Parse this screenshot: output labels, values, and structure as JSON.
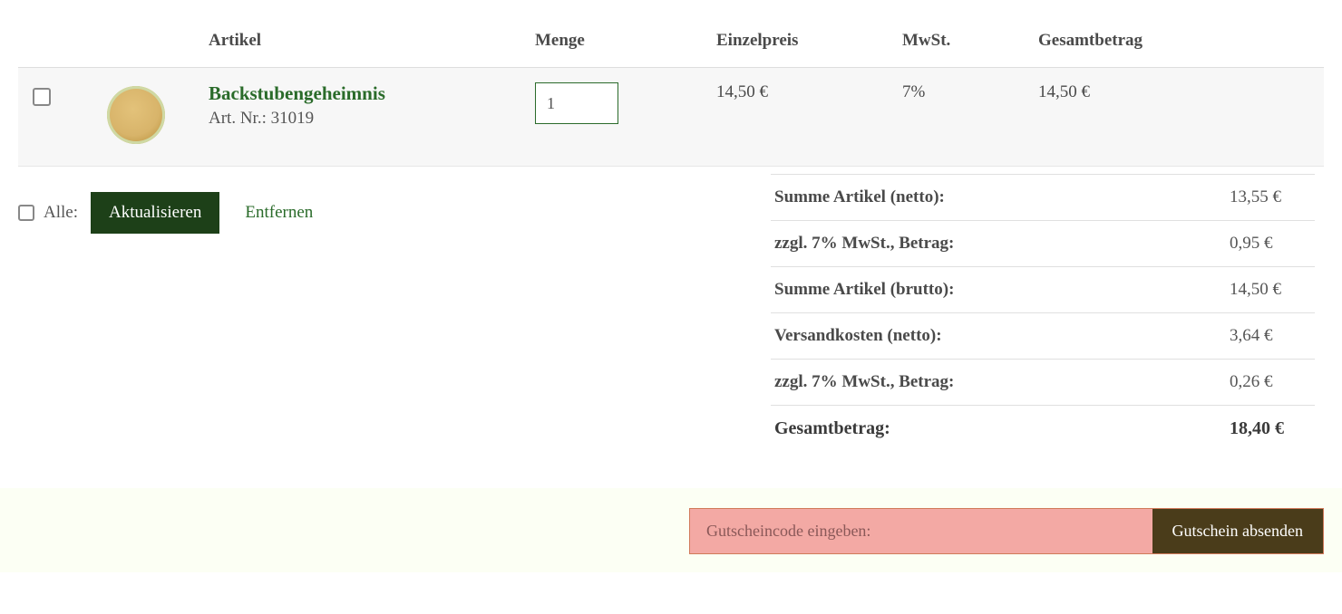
{
  "headers": {
    "article": "Artikel",
    "qty": "Menge",
    "unit_price": "Einzelpreis",
    "vat": "MwSt.",
    "total": "Gesamtbetrag"
  },
  "item": {
    "name": "Backstubengeheimnis",
    "sku_label": "Art. Nr.: 31019",
    "qty": "1",
    "unit_price": "14,50 €",
    "vat": "7%",
    "total": "14,50 €"
  },
  "actions": {
    "all_label": "Alle:",
    "update": "Aktualisieren",
    "remove": "Entfernen"
  },
  "totals": [
    {
      "label": "Summe Artikel (netto):",
      "value": "13,55 €"
    },
    {
      "label": "zzgl. 7% MwSt., Betrag:",
      "value": "0,95 €"
    },
    {
      "label": "Summe Artikel (brutto):",
      "value": "14,50 €"
    },
    {
      "label": "Versandkosten (netto):",
      "value": "3,64 €"
    },
    {
      "label": "zzgl. 7% MwSt., Betrag:",
      "value": "0,26 €"
    }
  ],
  "grand_total": {
    "label": "Gesamtbetrag:",
    "value": "18,40 €"
  },
  "coupon": {
    "placeholder": "Gutscheincode eingeben:",
    "button": "Gutschein absenden"
  }
}
